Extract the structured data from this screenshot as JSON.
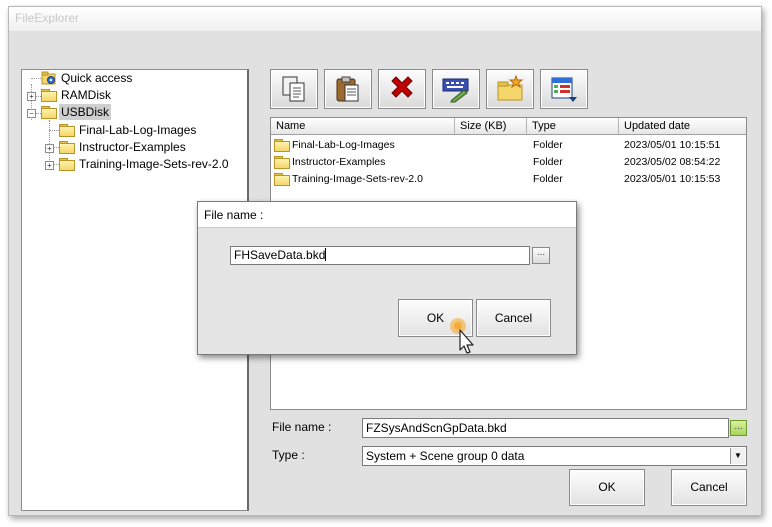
{
  "window": {
    "title": "FileExplorer"
  },
  "tree": {
    "items": [
      {
        "label": "Quick access"
      },
      {
        "label": "RAMDisk"
      },
      {
        "label": "USBDisk"
      },
      {
        "label": "Final-Lab-Log-Images"
      },
      {
        "label": "Instructor-Examples"
      },
      {
        "label": "Training-Image-Sets-rev-2.0"
      }
    ]
  },
  "toolbar": {
    "buttons": [
      {
        "icon": "copy-icon"
      },
      {
        "icon": "paste-icon"
      },
      {
        "icon": "delete-icon"
      },
      {
        "icon": "rename-icon"
      },
      {
        "icon": "new-folder-icon"
      },
      {
        "icon": "view-options-icon"
      }
    ]
  },
  "file_list": {
    "columns": [
      "Name",
      "Size (KB)",
      "Type",
      "Updated date"
    ],
    "rows": [
      {
        "name": "Final-Lab-Log-Images",
        "size": "",
        "type": "Folder",
        "date": "2023/05/01 10:15:51"
      },
      {
        "name": "Instructor-Examples",
        "size": "",
        "type": "Folder",
        "date": "2023/05/02 08:54:22"
      },
      {
        "name": "Training-Image-Sets-rev-2.0",
        "size": "",
        "type": "Folder",
        "date": "2023/05/01 10:15:53"
      }
    ]
  },
  "footer": {
    "file_name_label": "File name :",
    "file_name_value": "FZSysAndScnGpData.bkd",
    "type_label": "Type :",
    "type_value": "System + Scene group 0 data",
    "ok_label": "OK",
    "cancel_label": "Cancel"
  },
  "dialog": {
    "title": "File name :",
    "input_value": "FHSaveData.bkd",
    "browse_label": "...",
    "ok_label": "OK",
    "cancel_label": "Cancel"
  },
  "colors": {
    "folder": "#f4d56a",
    "delete": "#c00000",
    "accent_green": "#a7d45a",
    "cursor_highlight": "#f5a623"
  }
}
